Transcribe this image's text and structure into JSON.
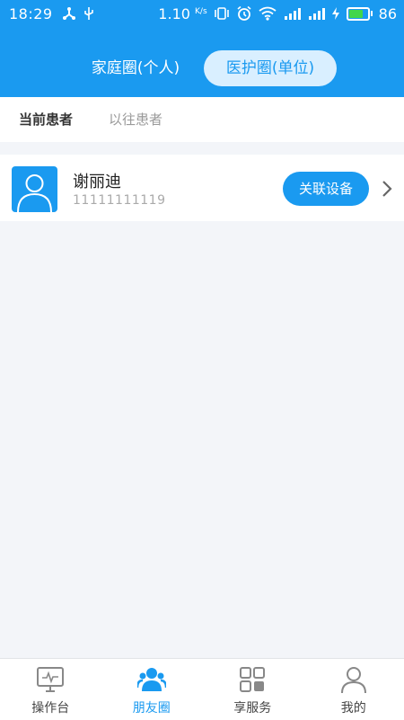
{
  "status_bar": {
    "time": "18:29",
    "speed": "1.10",
    "speed_unit": "K/s",
    "battery": "86",
    "battery_level": 0.86,
    "icons": [
      "usb-tether-icon",
      "usb-icon",
      "vibrate-icon",
      "alarm-icon",
      "wifi-icon",
      "signal-4g-icon",
      "signal-icon",
      "charging-icon",
      "battery-icon"
    ]
  },
  "header": {
    "segments": [
      {
        "label": "家庭圈(个人)",
        "active": false
      },
      {
        "label": "医护圈(单位)",
        "active": true
      }
    ]
  },
  "tabs": [
    {
      "label": "当前患者",
      "active": true
    },
    {
      "label": "以往患者",
      "active": false
    }
  ],
  "patients": [
    {
      "name": "谢丽迪",
      "phone": "11111111119",
      "action_label": "关联设备"
    }
  ],
  "bottom_nav": [
    {
      "label": "操作台",
      "icon": "monitor-icon",
      "active": false
    },
    {
      "label": "朋友圈",
      "icon": "friends-icon",
      "active": true
    },
    {
      "label": "享服务",
      "icon": "grid-icon",
      "active": false
    },
    {
      "label": "我的",
      "icon": "person-icon",
      "active": false
    }
  ],
  "colors": {
    "primary": "#1a9af0",
    "background": "#f3f5f9",
    "segment_active_bg": "#d9efff"
  }
}
